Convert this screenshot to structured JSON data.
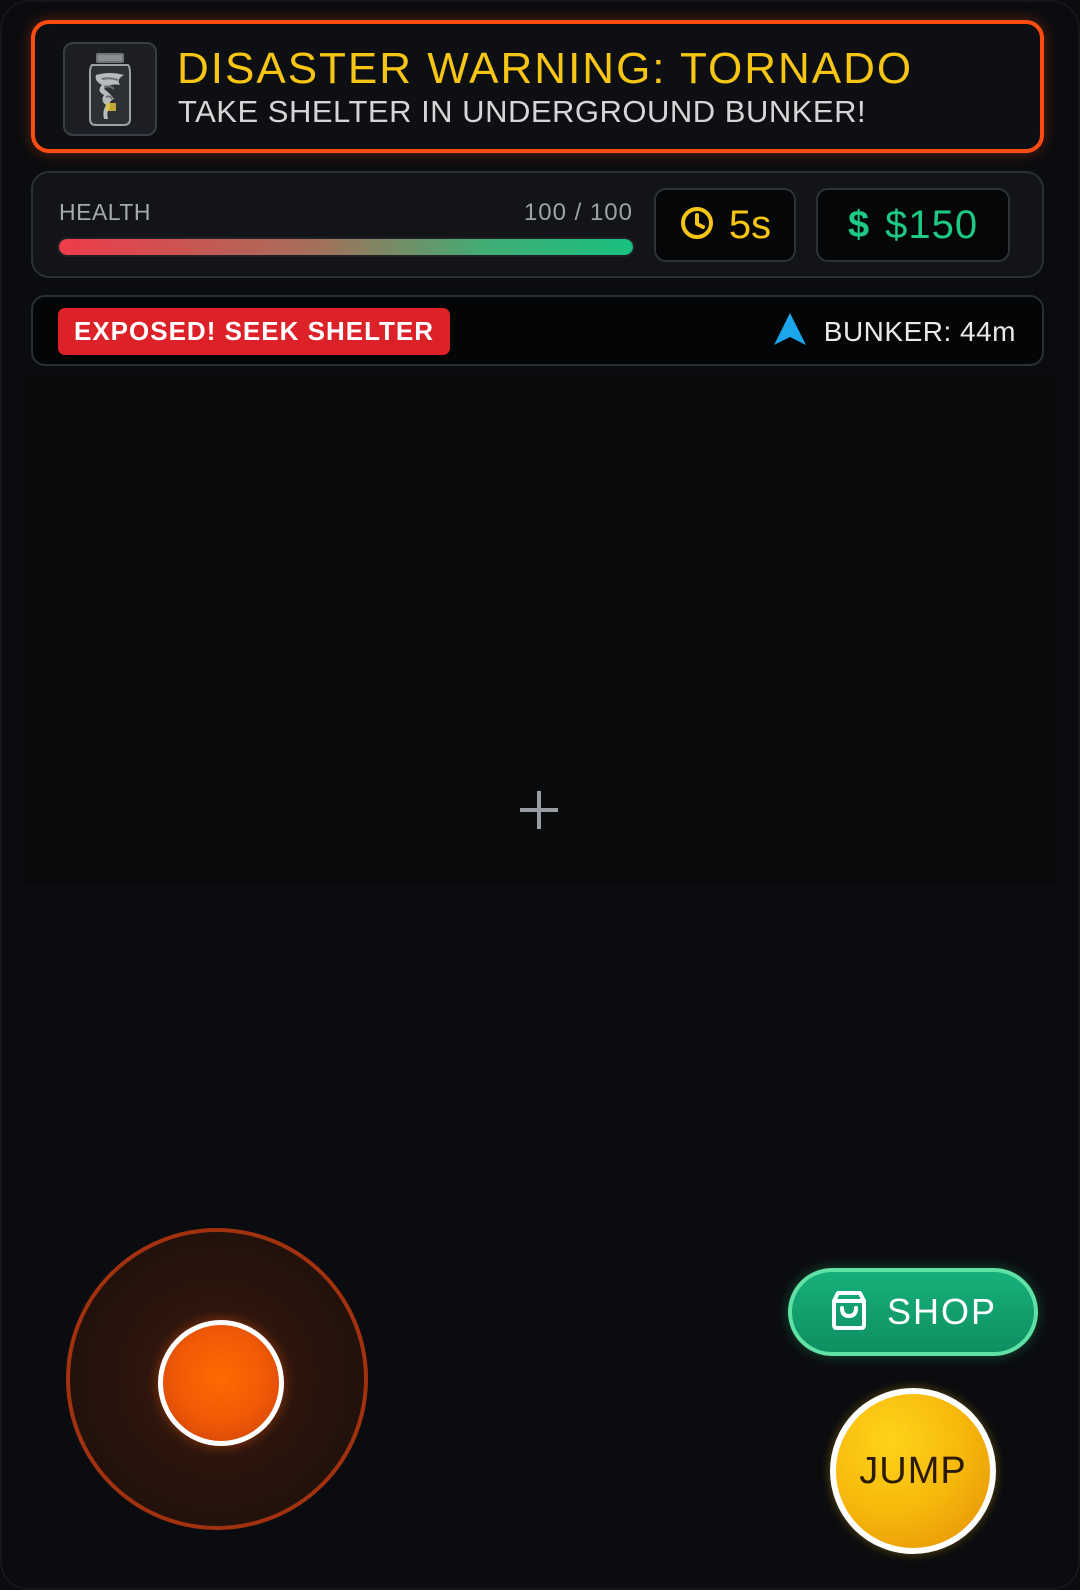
{
  "warning": {
    "title": "DISASTER WARNING: TORNADO",
    "subtitle": "TAKE SHELTER IN UNDERGROUND BUNKER!",
    "thumbnail_icon": "tornado-jar-icon",
    "border_color": "#ff4d12"
  },
  "stats": {
    "health_label": "HEALTH",
    "health_value": "100 / 100",
    "health_fraction": 1.0,
    "timer_icon": "clock-icon",
    "timer_value": "5s",
    "money_icon": "dollar-icon",
    "money_symbol": "$",
    "money_value": "$150"
  },
  "status": {
    "badge": "EXPOSED! SEEK SHELTER",
    "nav_icon": "navigation-arrow-icon",
    "bunker_distance": "BUNKER: 44m"
  },
  "controls": {
    "shop_icon": "shopping-bag-icon",
    "shop_label": "SHOP",
    "jump_label": "JUMP"
  },
  "colors": {
    "accent_yellow": "#f7c615",
    "money_green": "#1ec985",
    "danger_red": "#dc2128",
    "nav_blue": "#1aa7ec",
    "joystick_orange": "#f25a06"
  }
}
